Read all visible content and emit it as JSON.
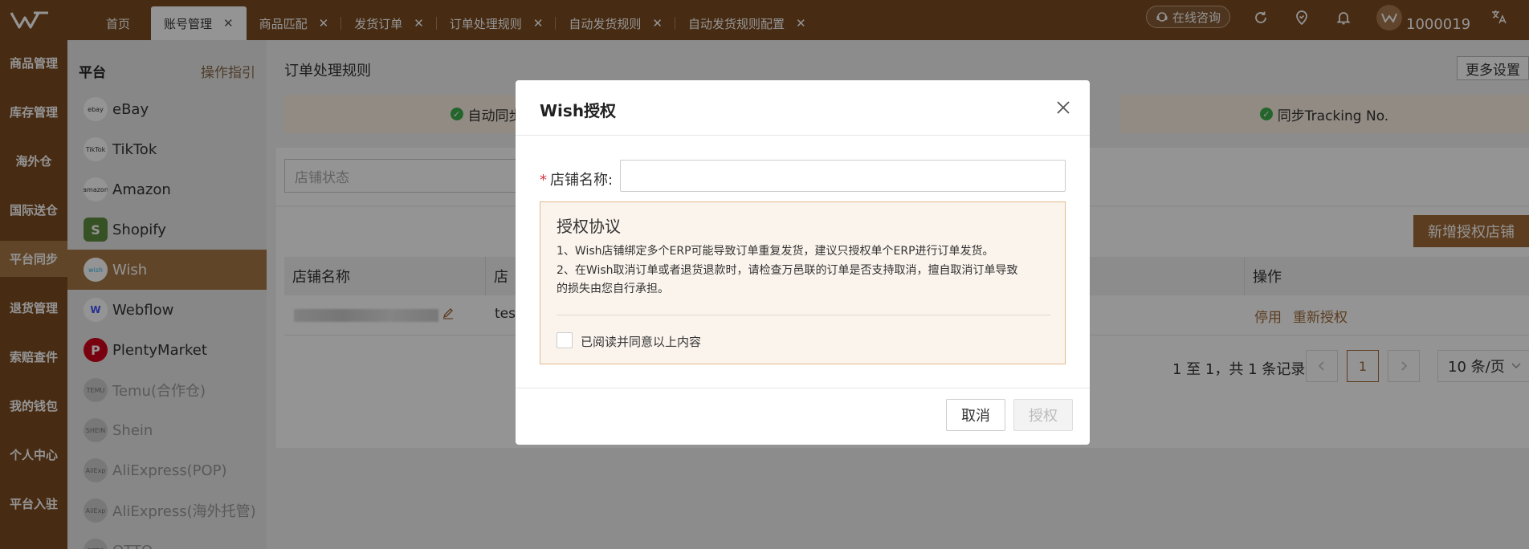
{
  "topbar": {
    "tabs": [
      {
        "label": "首页"
      },
      {
        "label": "账号管理"
      },
      {
        "label": "商品匹配"
      },
      {
        "label": "发货订单"
      },
      {
        "label": "订单处理规则"
      },
      {
        "label": "自动发货规则"
      },
      {
        "label": "自动发货规则配置"
      }
    ],
    "close_glyph": "✕",
    "consult_label": "在线咨询",
    "user_id": "1000019",
    "icons": [
      "refresh-icon",
      "location-icon",
      "bell-icon",
      "translate-icon"
    ]
  },
  "leftnav": {
    "items": [
      {
        "label": "商品管理"
      },
      {
        "label": "库存管理"
      },
      {
        "label": "海外仓"
      },
      {
        "label": "国际送仓"
      },
      {
        "label": "平台同步"
      },
      {
        "label": "退货管理"
      },
      {
        "label": "索赔查件"
      },
      {
        "label": "我的钱包"
      },
      {
        "label": "个人中心"
      },
      {
        "label": "平台入驻"
      }
    ],
    "active_index": 4
  },
  "platform_panel": {
    "title": "平台",
    "guide": "操作指引",
    "items": [
      {
        "label": "eBay",
        "icon_text": "ebay"
      },
      {
        "label": "TikTok",
        "icon_text": "TikTok"
      },
      {
        "label": "Amazon",
        "icon_text": "amazon"
      },
      {
        "label": "Shopify",
        "icon_text": "S"
      },
      {
        "label": "Wish",
        "icon_text": "wish"
      },
      {
        "label": "Webflow",
        "icon_text": "W"
      },
      {
        "label": "PlentyMarket",
        "icon_text": "P"
      },
      {
        "label": "Temu(合作仓)",
        "icon_text": "TEMU"
      },
      {
        "label": "Shein",
        "icon_text": "SHEIN"
      },
      {
        "label": "AliExpress(POP)",
        "icon_text": "AliExp"
      },
      {
        "label": "AliExpress(海外托管)",
        "icon_text": "AliExp"
      },
      {
        "label": "OTTO",
        "icon_text": "OTTO"
      }
    ],
    "active_index": 4
  },
  "main": {
    "title": "订单处理规则",
    "more_settings": "更多设置",
    "banners": [
      {
        "text": "自动同步订"
      },
      {
        "text": "同步Tracking No."
      }
    ],
    "filter_placeholder": "店铺状态",
    "add_shop": "新增授权店铺",
    "columns": [
      "店铺名称",
      "店",
      "操作"
    ],
    "row": {
      "shop_cell": "test",
      "op_disable": "停用",
      "op_reauth": "重新授权"
    },
    "pagination": {
      "info": "1 至 1，共 1 条记录",
      "current_page": "1",
      "page_size": "10 条/页"
    }
  },
  "modal": {
    "title": "Wish授权",
    "shop_name_label": "店铺名称:",
    "required_mark": "*",
    "agreement_title": "授权协议",
    "agreement_lines": [
      "1、Wish店铺绑定多个ERP可能导致订单重复发货，建议只授权单个ERP进行订单发货。",
      "2、在Wish取消订单或者退货退款时，请检查万邑联的订单是否支持取消，擅自取消订单导致",
      "的损失由您自行承担。"
    ],
    "agree_checkbox_label": "已阅读并同意以上内容",
    "cancel": "取消",
    "authorize": "授权"
  }
}
